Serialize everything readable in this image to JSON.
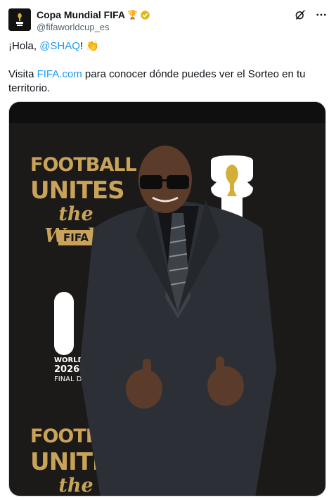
{
  "account": {
    "display_name": "Copa Mundial FIFA",
    "name_emoji": "🏆",
    "handle": "@fifaworldcup_es"
  },
  "tweet": {
    "greeting_prefix": "¡Hola, ",
    "mention": "@SHAQ",
    "greeting_suffix": "! ",
    "greeting_emoji": "👏",
    "line2_prefix": "Visita ",
    "link": "FIFA.com",
    "line2_suffix": " para conocer dónde puedes ver el Sorteo en tu territorio."
  },
  "backdrop": {
    "line1": "FOOTBALL",
    "line2": "UNITES",
    "line3": "the World",
    "badge": "FIFA",
    "draw_year": "2026",
    "draw_label1": "WORLD",
    "draw_label2": "FINAL DRAW"
  },
  "icons": {
    "verified": "verified-badge-icon",
    "grok": "grok-icon",
    "more": "more-dots-icon"
  },
  "colors": {
    "link": "#1d9bf0",
    "gold": "#c9a35a",
    "verified": "#e2b719",
    "backdrop": "#1b1a19"
  }
}
